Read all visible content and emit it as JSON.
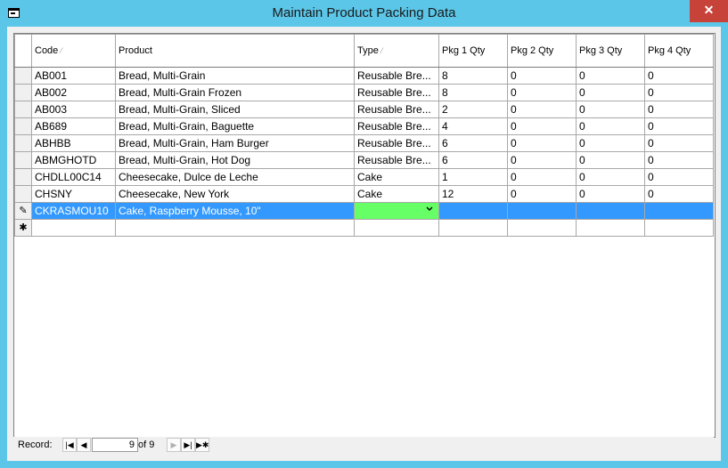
{
  "window": {
    "title": "Maintain Product Packing Data",
    "close_label": "✕"
  },
  "columns": [
    {
      "label": "Code",
      "sorted": true
    },
    {
      "label": "Product",
      "sorted": false
    },
    {
      "label": "Type",
      "sorted": true
    },
    {
      "label": "Pkg 1 Qty",
      "sorted": false
    },
    {
      "label": "Pkg 2 Qty",
      "sorted": false
    },
    {
      "label": "Pkg 3 Qty",
      "sorted": false
    },
    {
      "label": "Pkg 4 Qty",
      "sorted": false
    }
  ],
  "rows": [
    [
      "AB001",
      "Bread, Multi-Grain",
      "Reusable Bre...",
      "8",
      "0",
      "0",
      "0"
    ],
    [
      "AB002",
      "Bread, Multi-Grain Frozen",
      "Reusable Bre...",
      "8",
      "0",
      "0",
      "0"
    ],
    [
      "AB003",
      "Bread, Multi-Grain, Sliced",
      "Reusable Bre...",
      "2",
      "0",
      "0",
      "0"
    ],
    [
      "AB689",
      "Bread, Multi-Grain, Baguette",
      "Reusable Bre...",
      "4",
      "0",
      "0",
      "0"
    ],
    [
      "ABHBB",
      "Bread, Multi-Grain, Ham Burger",
      "Reusable Bre...",
      "6",
      "0",
      "0",
      "0"
    ],
    [
      "ABMGHOTD",
      "Bread, Multi-Grain, Hot Dog",
      "Reusable Bre...",
      "6",
      "0",
      "0",
      "0"
    ],
    [
      "CHDLL00C14",
      "Cheesecake, Dulce de Leche",
      "Cake",
      "1",
      "0",
      "0",
      "0"
    ],
    [
      "CHSNY",
      "Cheesecake, New York",
      "Cake",
      "12",
      "0",
      "0",
      "0"
    ]
  ],
  "editing_row": {
    "code": "CKRASMOU10",
    "product": "Cake, Raspberry Mousse, 10\"",
    "type": "",
    "pkg1": "",
    "pkg2": "",
    "pkg3": "",
    "pkg4": ""
  },
  "row_indicators": {
    "editing": "pencil-icon",
    "new": "new-record-icon"
  },
  "colors": {
    "selected_row": "#3399ff",
    "type_editor": "#66ff66",
    "title_bar": "#5bc6e8",
    "close_button": "#c7433a"
  },
  "navigation": {
    "label": "Record:",
    "current": "9",
    "of_text": "of 9"
  }
}
